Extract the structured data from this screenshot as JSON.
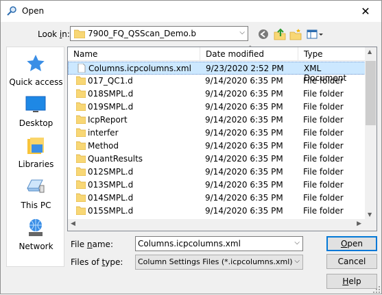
{
  "window": {
    "title": "Open",
    "close_glyph": "✕"
  },
  "toolbar": {
    "lookin_label_pre": "Look ",
    "lookin_label_u": "i",
    "lookin_label_post": "n:",
    "lookin_value": "7900_FQ_QSScan_Demo.b",
    "icons": [
      "back-icon",
      "up-folder-icon",
      "new-folder-icon",
      "view-menu-icon"
    ]
  },
  "places": [
    {
      "label": "Quick access",
      "icon": "star-icon"
    },
    {
      "label": "Desktop",
      "icon": "desktop-icon"
    },
    {
      "label": "Libraries",
      "icon": "libraries-icon"
    },
    {
      "label": "This PC",
      "icon": "computer-icon"
    },
    {
      "label": "Network",
      "icon": "network-icon"
    }
  ],
  "list": {
    "columns": [
      "Name",
      "Date modified",
      "Type"
    ],
    "rows": [
      {
        "name": "Columns.icpcolumns.xml",
        "date": "9/23/2020 2:52 PM",
        "type": "XML Document",
        "kind": "file",
        "selected": true
      },
      {
        "name": "017_QC1.d",
        "date": "9/14/2020 6:35 PM",
        "type": "File folder",
        "kind": "folder"
      },
      {
        "name": "018SMPL.d",
        "date": "9/14/2020 6:35 PM",
        "type": "File folder",
        "kind": "folder"
      },
      {
        "name": "019SMPL.d",
        "date": "9/14/2020 6:35 PM",
        "type": "File folder",
        "kind": "folder"
      },
      {
        "name": "IcpReport",
        "date": "9/14/2020 6:35 PM",
        "type": "File folder",
        "kind": "folder"
      },
      {
        "name": "interfer",
        "date": "9/14/2020 6:35 PM",
        "type": "File folder",
        "kind": "folder"
      },
      {
        "name": "Method",
        "date": "9/14/2020 6:35 PM",
        "type": "File folder",
        "kind": "folder"
      },
      {
        "name": "QuantResults",
        "date": "9/14/2020 6:35 PM",
        "type": "File folder",
        "kind": "folder"
      },
      {
        "name": "012SMPL.d",
        "date": "9/14/2020 6:35 PM",
        "type": "File folder",
        "kind": "folder"
      },
      {
        "name": "013SMPL.d",
        "date": "9/14/2020 6:35 PM",
        "type": "File folder",
        "kind": "folder"
      },
      {
        "name": "014SMPL.d",
        "date": "9/14/2020 6:35 PM",
        "type": "File folder",
        "kind": "folder"
      },
      {
        "name": "015SMPL.d",
        "date": "9/14/2020 6:35 PM",
        "type": "File folder",
        "kind": "folder"
      }
    ]
  },
  "form": {
    "filename_label_pre": "File ",
    "filename_label_u": "n",
    "filename_label_post": "ame:",
    "filename_value": "Columns.icpcolumns.xml",
    "filetype_label_pre": "Files of ",
    "filetype_label_u": "t",
    "filetype_label_post": "ype:",
    "filetype_value": "Column Settings Files (*.icpcolumns.xml)"
  },
  "buttons": {
    "open_u": "O",
    "open_rest": "pen",
    "cancel": "Cancel",
    "help_u": "H",
    "help_rest": "elp"
  },
  "colors": {
    "selection": "#cce8ff",
    "folder": "#f8d775",
    "accent": "#0078d7"
  }
}
